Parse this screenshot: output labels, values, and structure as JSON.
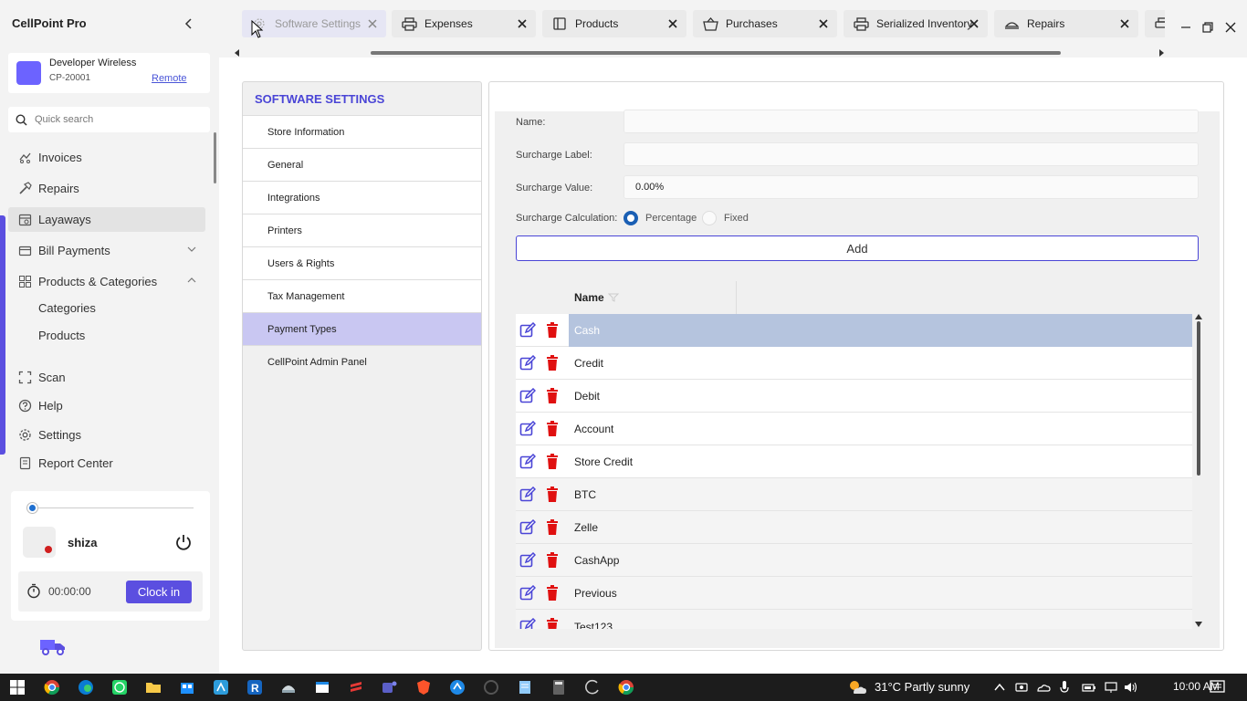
{
  "app": {
    "title": "CellPoint Pro"
  },
  "store": {
    "name": "Developer Wireless",
    "id": "CP-20001",
    "remote_label": "Remote"
  },
  "search": {
    "placeholder": "Quick search"
  },
  "sidebar": {
    "items": [
      {
        "label": "Invoices",
        "icon": "invoices-icon"
      },
      {
        "label": "Repairs",
        "icon": "hammer-icon"
      },
      {
        "label": "Layaways",
        "icon": "calendar-icon"
      },
      {
        "label": "Bill Payments",
        "icon": "wallet-icon"
      },
      {
        "label": "Products & Categories",
        "icon": "grid-icon"
      },
      {
        "label": "Scan",
        "icon": "scan-icon"
      },
      {
        "label": "Help",
        "icon": "help-icon"
      },
      {
        "label": "Settings",
        "icon": "settings-icon"
      },
      {
        "label": "Report Center",
        "icon": "report-icon"
      }
    ],
    "sub_items": [
      {
        "label": "Categories"
      },
      {
        "label": "Products"
      }
    ]
  },
  "user": {
    "name": "shiza",
    "timer": "00:00:00",
    "clock_in_label": "Clock in"
  },
  "tabs": [
    {
      "label": "Software Settings",
      "icon": "settings-icon"
    },
    {
      "label": "Expenses",
      "icon": "printer-icon"
    },
    {
      "label": "Products",
      "icon": "product-icon"
    },
    {
      "label": "Purchases",
      "icon": "basket-icon"
    },
    {
      "label": "Serialized Inventory",
      "icon": "printer-icon"
    },
    {
      "label": "Repairs",
      "icon": "repair-icon"
    }
  ],
  "settings_nav": {
    "title": "SOFTWARE SETTINGS",
    "items": [
      {
        "label": "Store Information"
      },
      {
        "label": "General"
      },
      {
        "label": "Integrations"
      },
      {
        "label": "Printers"
      },
      {
        "label": "Users & Rights"
      },
      {
        "label": "Tax Management"
      },
      {
        "label": "Payment Types"
      },
      {
        "label": "CellPoint Admin Panel"
      }
    ],
    "active": "Payment Types"
  },
  "form": {
    "name_label": "Name:",
    "name_value": "",
    "surcharge_label_label": "Surcharge Label:",
    "surcharge_label_value": "",
    "surcharge_value_label": "Surcharge Value:",
    "surcharge_value_value": "0.00%",
    "calc_label": "Surcharge Calculation:",
    "calc_options": [
      {
        "label": "Percentage",
        "selected": true
      },
      {
        "label": "Fixed",
        "selected": false
      }
    ],
    "add_label": "Add"
  },
  "grid": {
    "header_name": "Name",
    "rows": [
      {
        "name": "Cash"
      },
      {
        "name": "Credit"
      },
      {
        "name": "Debit"
      },
      {
        "name": "Account"
      },
      {
        "name": "Store Credit"
      },
      {
        "name": "BTC"
      },
      {
        "name": "Zelle"
      },
      {
        "name": "CashApp"
      },
      {
        "name": "Previous"
      },
      {
        "name": "Test123"
      }
    ],
    "selected": "Cash"
  },
  "taskbar": {
    "weather": "31°C  Partly sunny",
    "time": "10:00 AM"
  },
  "colors": {
    "accent": "#5b4fe0",
    "selected_row": "#b5c4de",
    "active_nav": "#c9c7f2",
    "delete": "#e01010",
    "edit": "#4a45d6"
  }
}
